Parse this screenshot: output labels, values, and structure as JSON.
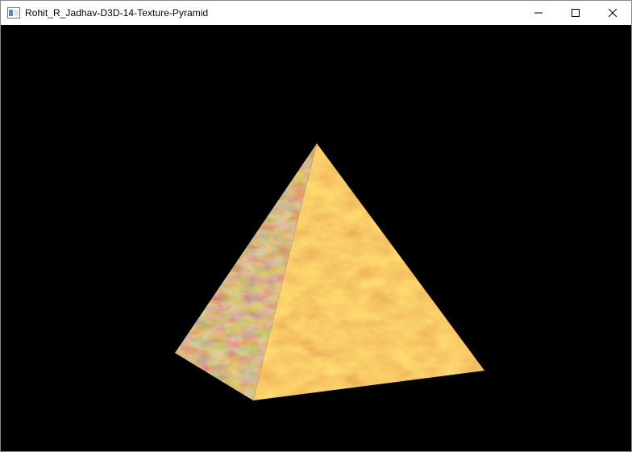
{
  "window": {
    "title": "Rohit_R_Jadhav-D3D-14-Texture-Pyramid",
    "app_icon": "window-app-icon",
    "controls": {
      "minimize_icon": "minimize-icon",
      "maximize_icon": "maximize-icon",
      "close_icon": "close-icon"
    }
  },
  "scene": {
    "background_color": "#000000",
    "object": "textured-pyramid",
    "texture": "stone-marble",
    "texture_colors": [
      "#c9863f",
      "#e0b574",
      "#a85a26",
      "#f0d6a0",
      "#7a4a22"
    ]
  }
}
